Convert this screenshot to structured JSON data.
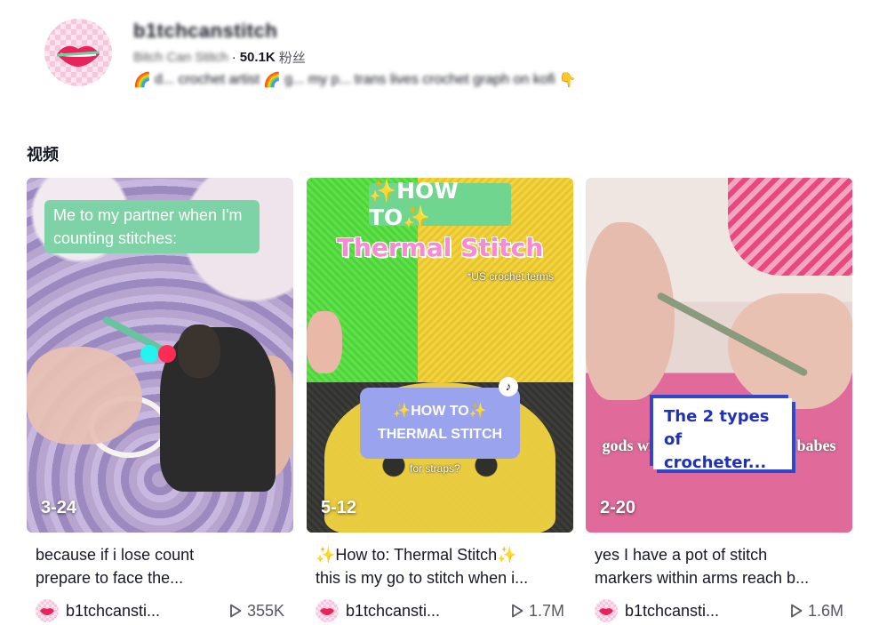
{
  "profile": {
    "username": "b1tchcanstitch",
    "nickname": "Bitch Can Stitch",
    "followers": "50.1K",
    "followers_label": "粉丝",
    "bio_prefix_emoji": "🌈",
    "bio_blur_1": "d...  crochet artist",
    "bio_mid_emoji": "🌈",
    "bio_blur_2": "g... my p...",
    "bio_tail": "trans lives crochet graph on kofi",
    "bio_end_emoji": "👇"
  },
  "section_title": "视频",
  "videos": [
    {
      "date": "3-24",
      "thumb_text": "Me to my partner when I'm counting stitches:",
      "caption_line1": "because if i lose count",
      "caption_line2": "prepare to face the...",
      "author": "b1tchcansti...",
      "plays": "355K"
    },
    {
      "date": "5-12",
      "thumb_text_1": "✨HOW TO✨",
      "thumb_text_2": "Thermal Stitch",
      "thumb_text_3": "*US crochet terms",
      "thumb_pill_1": "✨HOW TO✨",
      "thumb_pill_2": "THERMAL STITCH",
      "thumb_text_4": "for straps?",
      "caption_line1": "✨How to: Thermal Stitch✨",
      "caption_line2": "this is my go to stitch when i...",
      "author": "b1tchcansti...",
      "plays": "1.7M"
    },
    {
      "date": "2-20",
      "thumb_window": "The 2 types of crocheter...",
      "thumb_overlay": "gods will shine down on you babes",
      "caption_line1": "yes I have a pot of stitch",
      "caption_line2": "markers within arms reach b...",
      "author": "b1tchcansti...",
      "plays": "1.6M"
    }
  ],
  "icons": {
    "play": "play-icon",
    "tiktok": "tiktok-logo-icon"
  },
  "colors": {
    "accent_red": "#fe2c55",
    "accent_cyan": "#25f4ee",
    "text_primary": "#161823",
    "text_secondary": "#57575f"
  }
}
